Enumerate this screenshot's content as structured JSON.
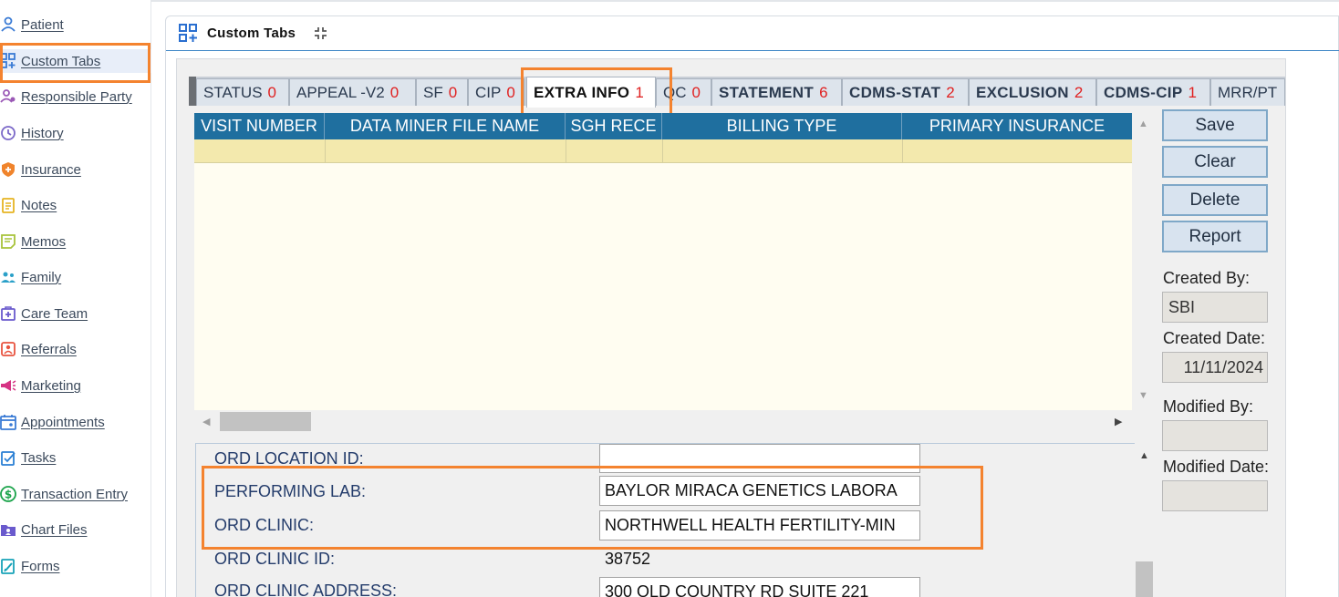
{
  "sidebar": {
    "items": [
      {
        "label": "Patient",
        "icon": "person-icon",
        "color": "#3a7bd5"
      },
      {
        "label": "Custom Tabs",
        "icon": "custom-tabs-icon",
        "color": "#3a7bd5"
      },
      {
        "label": "Responsible Party",
        "icon": "responsible-party-icon",
        "color": "#9b59b6"
      },
      {
        "label": "History",
        "icon": "history-clock-icon",
        "color": "#7b68c8"
      },
      {
        "label": "Insurance",
        "icon": "insurance-shield-icon",
        "color": "#f0842c"
      },
      {
        "label": "Notes",
        "icon": "notes-icon",
        "color": "#e6b422"
      },
      {
        "label": "Memos",
        "icon": "memos-icon",
        "color": "#a8c33a"
      },
      {
        "label": "Family",
        "icon": "family-icon",
        "color": "#2aa0c8"
      },
      {
        "label": "Care Team",
        "icon": "care-team-icon",
        "color": "#6a5acd"
      },
      {
        "label": "Referrals",
        "icon": "referrals-icon",
        "color": "#e8533f"
      },
      {
        "label": "Marketing",
        "icon": "marketing-megaphone-icon",
        "color": "#d63384"
      },
      {
        "label": "Appointments",
        "icon": "calendar-icon",
        "color": "#3a7bd5"
      },
      {
        "label": "Tasks",
        "icon": "tasks-icon",
        "color": "#2a7fd4"
      },
      {
        "label": "Transaction Entry",
        "icon": "dollar-icon",
        "color": "#1aa34a"
      },
      {
        "label": "Chart Files",
        "icon": "chart-files-icon",
        "color": "#6a5acd"
      },
      {
        "label": "Forms",
        "icon": "forms-icon",
        "color": "#17a2b8"
      }
    ]
  },
  "panel": {
    "title": "Custom Tabs",
    "header_icon": "custom-tabs-icon",
    "collapse_icon": "collapse-icon"
  },
  "tabs": [
    {
      "label": "STATUS",
      "count": "0",
      "bold": false
    },
    {
      "label": "APPEAL -V2",
      "count": "0",
      "bold": false
    },
    {
      "label": "SF",
      "count": "0",
      "bold": false
    },
    {
      "label": "CIP",
      "count": "0",
      "bold": false
    },
    {
      "label": "EXTRA INFO",
      "count": "1",
      "bold": true,
      "active": true
    },
    {
      "label": "QC",
      "count": "0",
      "bold": false
    },
    {
      "label": "STATEMENT",
      "count": "6",
      "bold": true
    },
    {
      "label": "CDMS-STAT",
      "count": "2",
      "bold": true
    },
    {
      "label": "EXCLUSION",
      "count": "2",
      "bold": true
    },
    {
      "label": "CDMS-CIP",
      "count": "1",
      "bold": true
    },
    {
      "label": "MRR/PT",
      "count": "",
      "bold": false
    }
  ],
  "grid": {
    "columns": [
      "VISIT NUMBER",
      "DATA MINER FILE NAME",
      "SGH RECE",
      "BILLING TYPE",
      "PRIMARY INSURANCE"
    ]
  },
  "actions": {
    "save": "Save",
    "clear": "Clear",
    "delete": "Delete",
    "report": "Report"
  },
  "audit": {
    "created_by_label": "Created By:",
    "created_by": "SBI",
    "created_date_label": "Created Date:",
    "created_date": "11/11/2024",
    "modified_by_label": "Modified By:",
    "modified_by": "",
    "modified_date_label": "Modified Date:",
    "modified_date": ""
  },
  "details": {
    "ord_location_id_label": "ORD LOCATION ID:",
    "ord_location_id": "",
    "performing_lab_label": "PERFORMING LAB:",
    "performing_lab": "BAYLOR MIRACA GENETICS LABORA",
    "ord_clinic_label": "ORD CLINIC:",
    "ord_clinic": "NORTHWELL HEALTH FERTILITY-MIN",
    "ord_clinic_id_label": "ORD CLINIC ID:",
    "ord_clinic_id": "38752",
    "ord_clinic_address_label": "ORD CLINIC ADDRESS:",
    "ord_clinic_address": "300 OLD COUNTRY RD SUITE 221"
  },
  "colors": {
    "highlight": "#f4832f",
    "grid_header": "#1f6f9f",
    "grid_row": "#f3e9ad",
    "count_red": "#e02020"
  }
}
